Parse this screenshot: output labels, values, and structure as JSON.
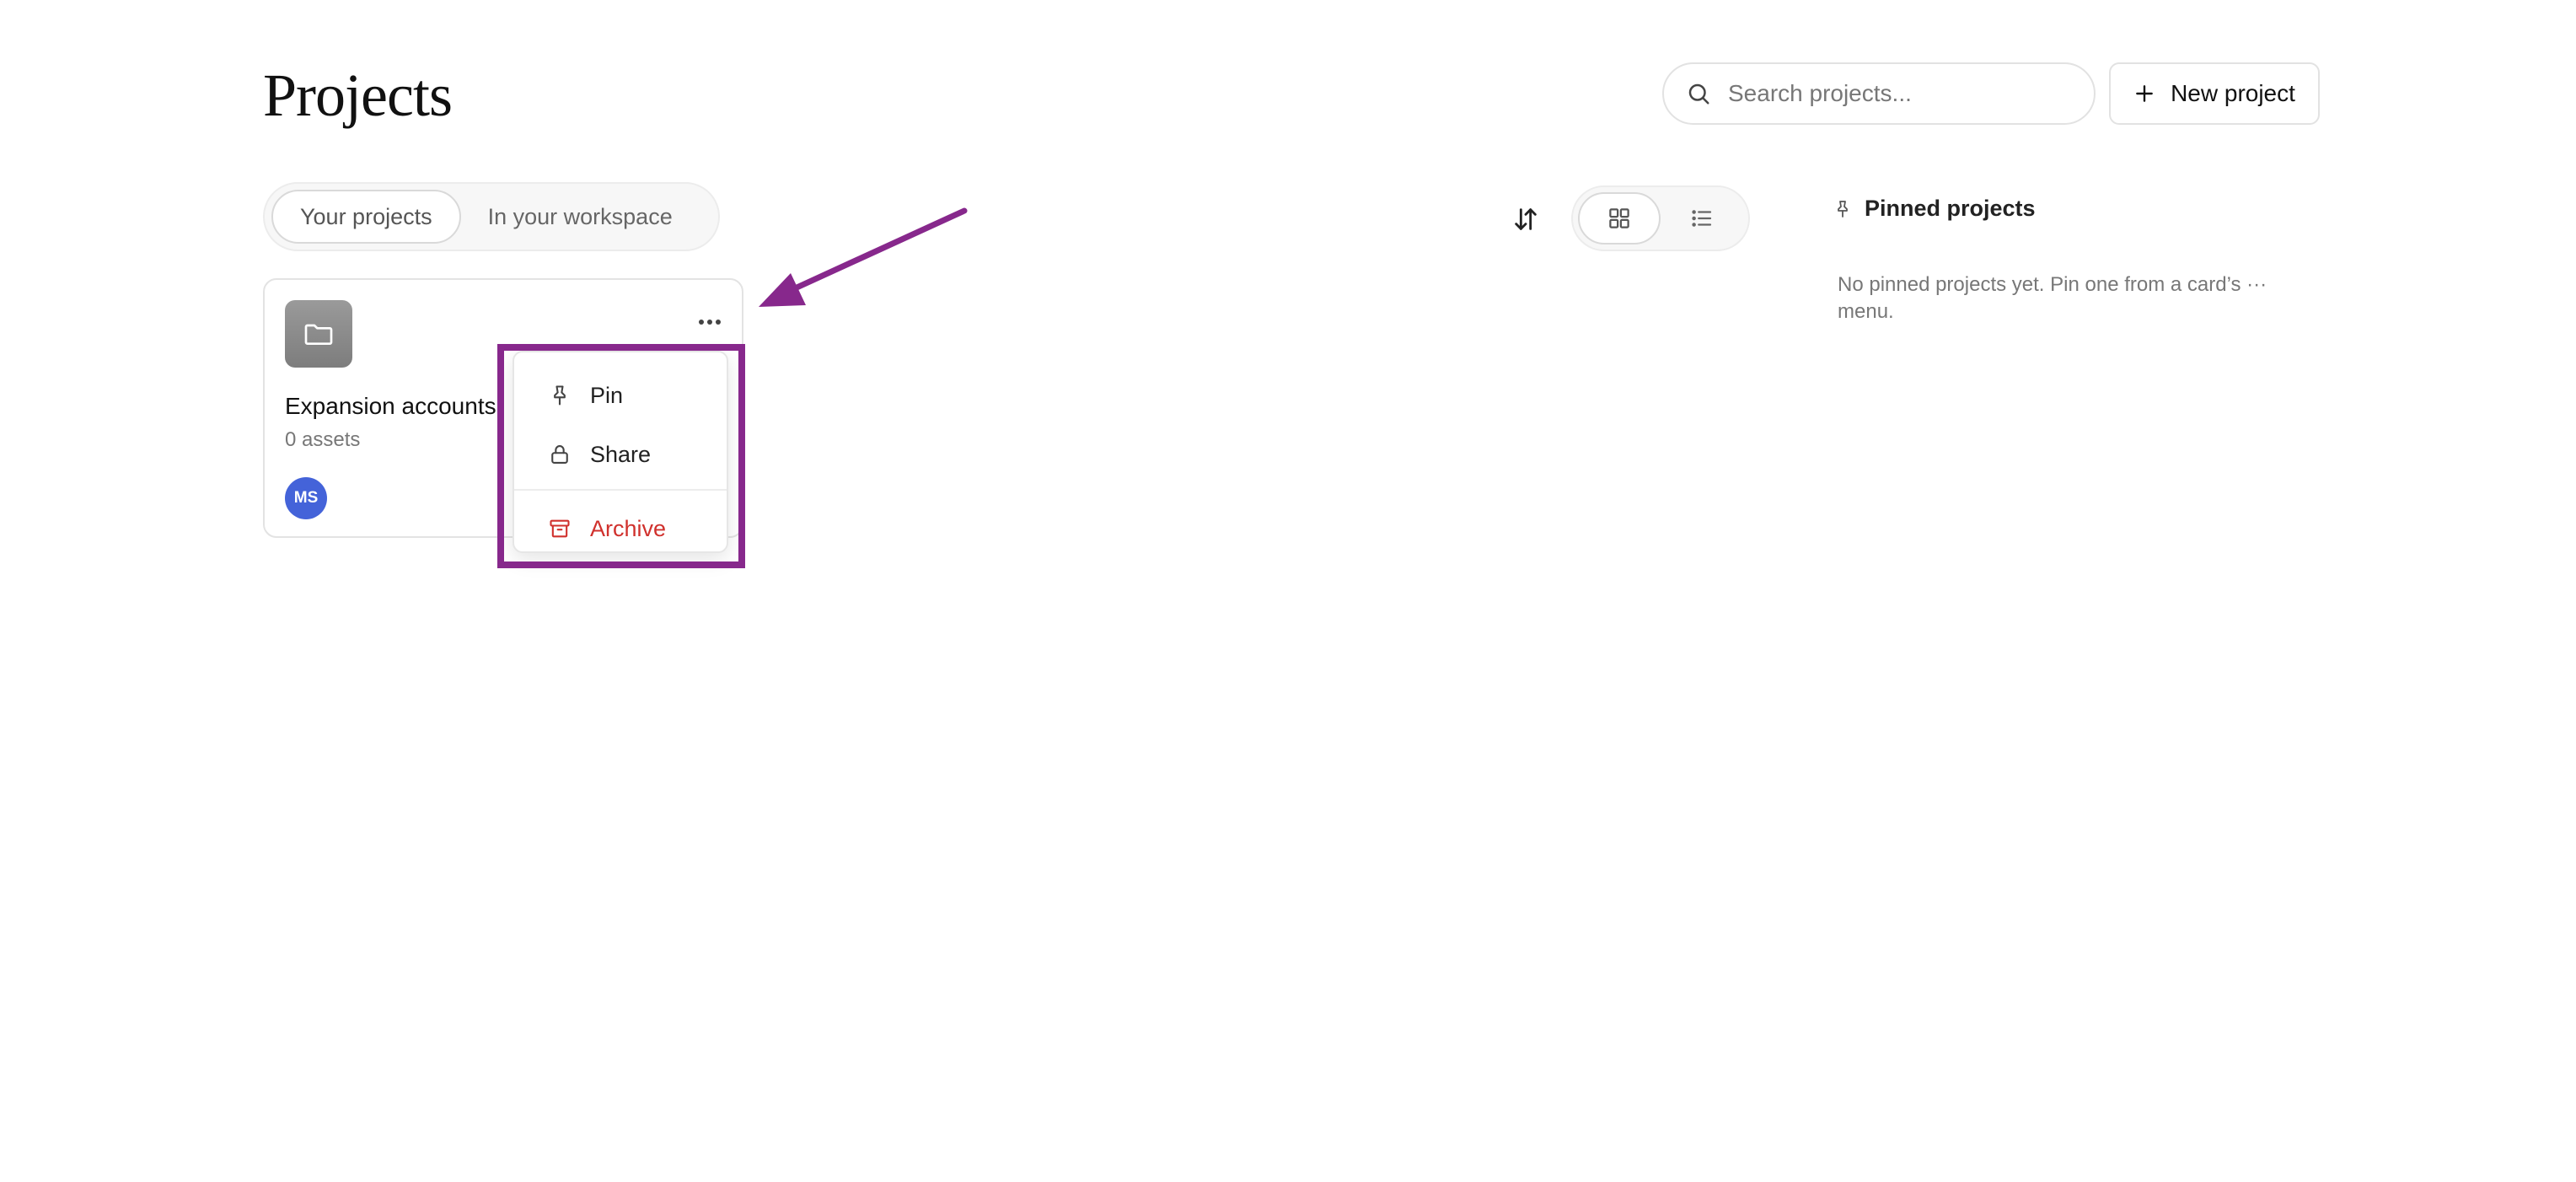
{
  "header": {
    "title": "Projects",
    "search": {
      "placeholder": "Search projects..."
    },
    "new_project_label": "New project"
  },
  "tabs": [
    {
      "label": "Your projects",
      "active": true
    },
    {
      "label": "In your workspace",
      "active": false
    }
  ],
  "toolbar": {
    "sort_icon": "sort-arrows-icon",
    "view_modes": [
      {
        "icon": "grid-icon",
        "active": true
      },
      {
        "icon": "list-icon",
        "active": false
      }
    ]
  },
  "pinned": {
    "title": "Pinned projects",
    "empty_text": "No pinned projects yet. Pin one from a card’s ··· menu."
  },
  "projects": [
    {
      "name": "Expansion accounts",
      "assets": "0 assets",
      "owner_initials": "MS",
      "avatar_color": "#4463d9"
    }
  ],
  "card_menu": {
    "items": [
      {
        "label": "Pin",
        "icon": "pin-icon"
      },
      {
        "label": "Share",
        "icon": "lock-icon"
      },
      {
        "label": "Archive",
        "icon": "archive-icon",
        "danger": true,
        "color": "#d0312d"
      }
    ]
  },
  "annotation": {
    "color": "#87288c"
  }
}
